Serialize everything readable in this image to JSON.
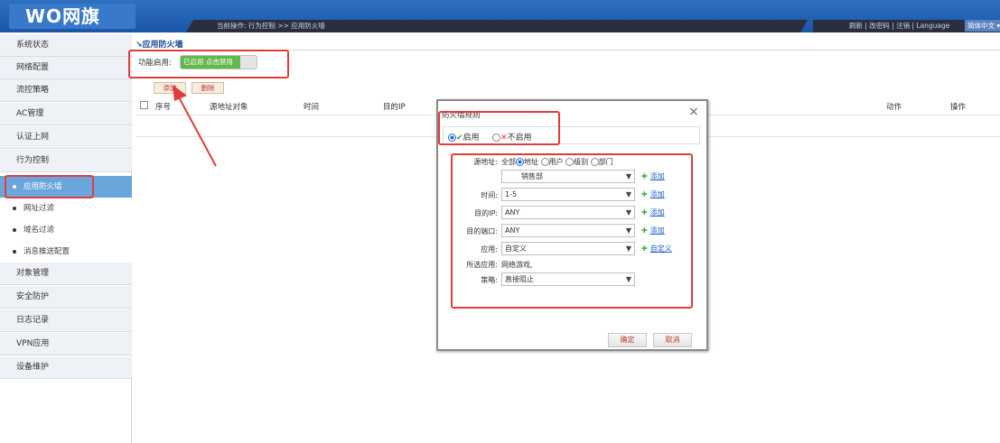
{
  "header": {
    "logo": "WO网旗",
    "breadcrumb": "当前操作: 行为控制 >> 应用防火墙",
    "links": "刷新 | 改密码 | 注销 | Language",
    "language": "简体中文"
  },
  "sidebar": {
    "items": [
      {
        "label": "系统状态"
      },
      {
        "label": "网络配置"
      },
      {
        "label": "流控策略"
      },
      {
        "label": "AC管理"
      },
      {
        "label": "认证上网"
      },
      {
        "label": "行为控制"
      }
    ],
    "sub_items": [
      {
        "label": "应用防火墙",
        "active": true
      },
      {
        "label": "网址过滤"
      },
      {
        "label": "域名过滤"
      },
      {
        "label": "消息推送配置"
      }
    ],
    "items_after": [
      {
        "label": "对象管理"
      },
      {
        "label": "安全防护"
      },
      {
        "label": "日志记录"
      },
      {
        "label": "VPN应用"
      },
      {
        "label": "设备维护"
      }
    ]
  },
  "main": {
    "title": "应用防火墙",
    "enable_label": "功能启用:",
    "toggle_text": "已启用 点击禁用",
    "add_button": "添加",
    "delete_button": "删除",
    "columns": [
      "序号",
      "源地址对象",
      "时间",
      "目的IP",
      "动作",
      "操作"
    ]
  },
  "dialog": {
    "title": "防火墙规则",
    "status": {
      "enabled_label": "启用",
      "disabled_label": "不启用",
      "selected": "启用"
    },
    "source_label": "源地址:",
    "source_options": [
      "全部",
      "地址",
      "用户",
      "级别",
      "部门"
    ],
    "source_value": "销售部",
    "time_label": "时间:",
    "time_value": "1-5",
    "dest_ip_label": "目的IP:",
    "dest_ip_value": "ANY",
    "dest_port_label": "目的端口:",
    "dest_port_value": "ANY",
    "app_label": "应用:",
    "app_value": "自定义",
    "selected_app_label": "所选应用:",
    "selected_app_value": "网络游戏,",
    "policy_label": "策略:",
    "policy_value": "直接阻止",
    "add_link": "添加",
    "custom_link": "自定义",
    "ok": "确定",
    "cancel": "取消"
  },
  "colors": {
    "header": "#1b56a6",
    "active_sub": "#6aa5dc",
    "toggle_on": "#62b84a",
    "annotation": "#e23b3b"
  }
}
